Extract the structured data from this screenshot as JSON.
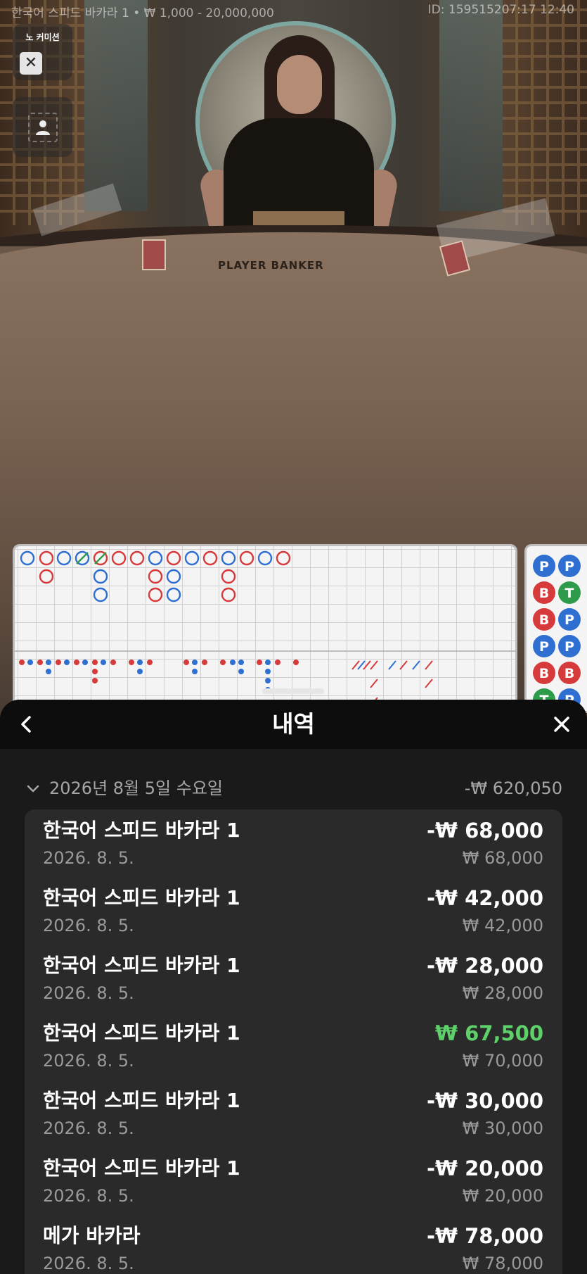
{
  "video": {
    "table_title": "한국어 스피드 바카라 1 • ₩ 1,000 - 20,000,000",
    "round_id": "ID: 159515207:17 12:40",
    "table_print": "PLAYER   BANKER"
  },
  "side_panel": {
    "mode_label": "노 커미션",
    "close_glyph": "✕"
  },
  "sheet": {
    "title": "내역",
    "date_group": {
      "date": "2026년 8월 5일 수요일",
      "total": "-₩ 620,050"
    },
    "items": [
      {
        "game": "한국어 스피드 바카라 1",
        "date": "2026. 8. 5.",
        "result": "-₩ 68,000",
        "stake": "₩ 68,000",
        "win": false
      },
      {
        "game": "한국어 스피드 바카라 1",
        "date": "2026. 8. 5.",
        "result": "-₩ 42,000",
        "stake": "₩ 42,000",
        "win": false
      },
      {
        "game": "한국어 스피드 바카라 1",
        "date": "2026. 8. 5.",
        "result": "-₩ 28,000",
        "stake": "₩ 28,000",
        "win": false
      },
      {
        "game": "한국어 스피드 바카라 1",
        "date": "2026. 8. 5.",
        "result": "₩ 67,500",
        "stake": "₩ 70,000",
        "win": true
      },
      {
        "game": "한국어 스피드 바카라 1",
        "date": "2026. 8. 5.",
        "result": "-₩ 30,000",
        "stake": "₩ 30,000",
        "win": false
      },
      {
        "game": "한국어 스피드 바카라 1",
        "date": "2026. 8. 5.",
        "result": "-₩ 20,000",
        "stake": "₩ 20,000",
        "win": false
      },
      {
        "game": "메가 바카라",
        "date": "2026. 8. 5.",
        "result": "-₩ 78,000",
        "stake": "₩ 78,000",
        "win": false
      }
    ]
  },
  "bead_road": {
    "labels": [
      "P",
      "P",
      "B",
      "T",
      "B",
      "P",
      "P",
      "P",
      "B",
      "B",
      "T",
      "P"
    ],
    "colors": {
      "P": "#2f6fd1",
      "B": "#d63a3a",
      "T": "#2e9b4a"
    }
  },
  "colors": {
    "win": "#5fd16b",
    "player": "#2f6fd1",
    "banker": "#d63a3a",
    "tie": "#2e9b4a"
  }
}
